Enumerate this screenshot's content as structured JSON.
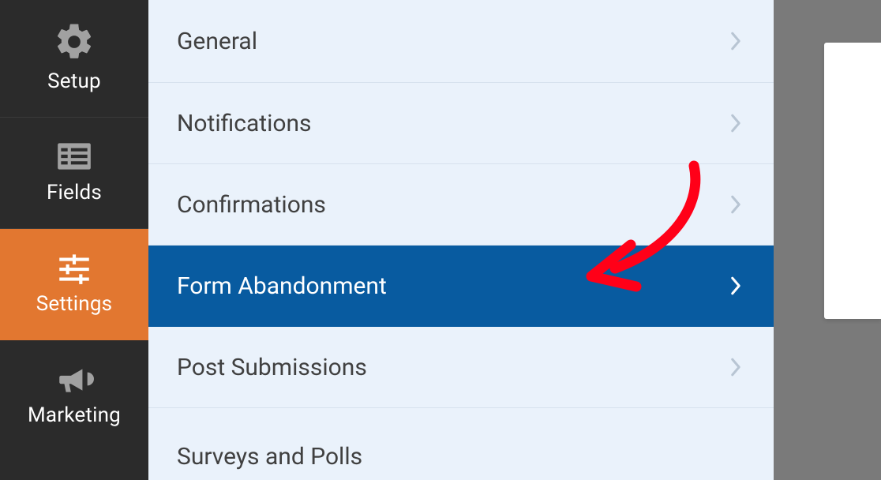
{
  "sidebar": {
    "items": [
      {
        "label": "Setup"
      },
      {
        "label": "Fields"
      },
      {
        "label": "Settings"
      },
      {
        "label": "Marketing"
      }
    ]
  },
  "settings": {
    "rows": [
      {
        "label": "General"
      },
      {
        "label": "Notifications"
      },
      {
        "label": "Confirmations"
      },
      {
        "label": "Form Abandonment"
      },
      {
        "label": "Post Submissions"
      },
      {
        "label": "Surveys and Polls"
      }
    ]
  },
  "colors": {
    "sidebar_bg": "#2b2b2b",
    "active_orange": "#e27730",
    "panel_bg": "#eaf2fb",
    "row_active": "#085ba0",
    "annotation": "#ff0018"
  }
}
